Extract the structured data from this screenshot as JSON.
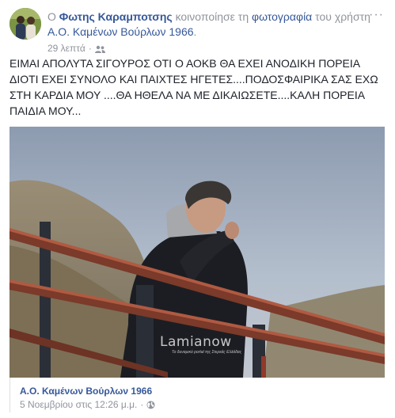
{
  "header": {
    "prefix": "Ο",
    "author": "Φωτης Καραμποτσης",
    "action": "κοινοποίησε τη",
    "object": "φωτογραφία",
    "suffix": "του",
    "owner_prefix": "χρήστη",
    "owner": "Α.Ο. Καμένων Βούρλων 1966",
    "owner_suffix": ".",
    "time": "29 λεπτά",
    "separator": "·",
    "privacy_icon": "friends-icon",
    "more_label": "···"
  },
  "post": {
    "text": "ΕΙΜΑΙ ΑΠΟΛΥΤΑ ΣΙΓΟΥΡΟΣ ΟΤΙ Ο ΑΟΚΒ ΘΑ ΕΧΕΙ ΑΝΟΔΙΚΗ ΠΟΡΕΙΑ ΔΙΟΤΙ ΕΧΕΙ ΣΥΝΟΛΟ ΚΑΙ ΠΑΙΧΤΕΣ ΗΓΕΤΕΣ....ΠΟΔΟΣΦΑΙΡΙΚΑ ΣΑΣ ΕΧΩ ΣΤΗ ΚΑΡΔΙΑ ΜΟΥ ....ΘΑ ΗΘΕΛΑ ΝΑ ΜΕ ΔΙΚΑΙΩΣΕΤΕ....ΚΑΛΗ ΠΟΡΕΙΑ ΠΑΙΔΙΑ ΜΟΥ..."
  },
  "photo": {
    "watermark": "Lamianow",
    "watermark_sub": "Το δυναμικό portal της Στερεάς Ελλάδας"
  },
  "shared": {
    "name": "Α.Ο. Καμένων Βούρλων 1966",
    "date": "5 Νοεμβρίου στις 12:26 μ.μ.",
    "separator": "·",
    "privacy_icon": "globe-icon"
  },
  "colors": {
    "link": "#365899",
    "meta": "#90949c",
    "text": "#1d2129"
  }
}
